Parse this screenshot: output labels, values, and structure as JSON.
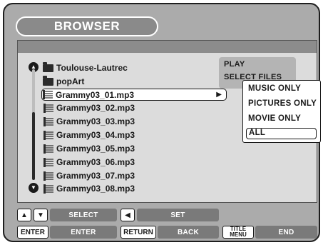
{
  "title": "BROWSER",
  "files": [
    {
      "type": "folder",
      "name": "Toulouse-Lautrec"
    },
    {
      "type": "folder",
      "name": "popArt"
    },
    {
      "type": "file",
      "name": "Grammy03_01.mp3",
      "selected": true
    },
    {
      "type": "file",
      "name": "Grammy03_02.mp3"
    },
    {
      "type": "file",
      "name": "Grammy03_03.mp3"
    },
    {
      "type": "file",
      "name": "Grammy03_04.mp3"
    },
    {
      "type": "file",
      "name": "Grammy03_05.mp3"
    },
    {
      "type": "file",
      "name": "Grammy03_06.mp3"
    },
    {
      "type": "file",
      "name": "Grammy03_07.mp3"
    },
    {
      "type": "file",
      "name": "Grammy03_08.mp3"
    }
  ],
  "side_menu": {
    "play": "PLAY",
    "select_files": "SELECT FILES"
  },
  "filter_popup": {
    "items": [
      "MUSIC ONLY",
      "PICTURES ONLY",
      "MOVIE ONLY",
      "ALL"
    ],
    "highlighted": "ALL"
  },
  "controls": {
    "select_label": "SELECT",
    "set_label": "SET",
    "enter_key": "ENTER",
    "enter_label": "ENTER",
    "return_key": "RETURN",
    "back_label": "BACK",
    "title_menu_key_line1": "TITLE",
    "title_menu_key_line2": "MENU",
    "end_label": "END"
  },
  "colors": {
    "frame_bg": "#ababab",
    "panel_bg": "#dcdcdc",
    "header_bar": "#8c8c8c",
    "button_bg": "#7a7a7a",
    "text_dark": "#1a1a1a"
  }
}
